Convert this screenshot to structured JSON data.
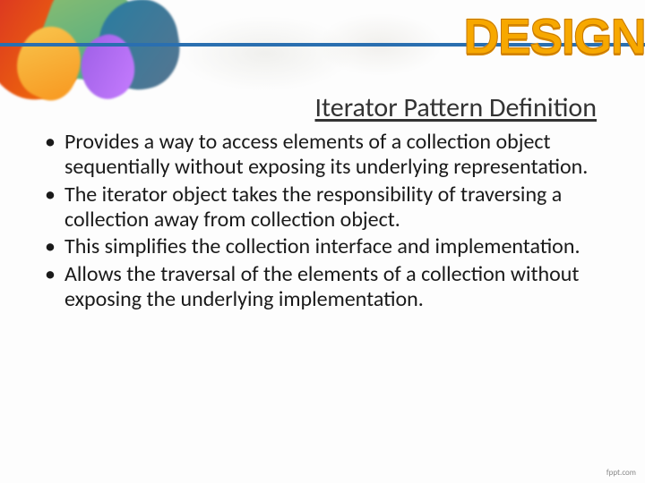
{
  "brand": "DESIGN",
  "title": "Iterator Pattern Definition",
  "bullets": [
    "Provides a way to access elements of a collection object sequentially without exposing its underlying representation.",
    "The iterator object takes the responsibility of traversing a collection away from collection object.",
    "This  simplifies the collection interface and implementation.",
    "Allows the traversal of the elements of a collection without exposing the underlying implementation."
  ],
  "footer": "fppt.com"
}
